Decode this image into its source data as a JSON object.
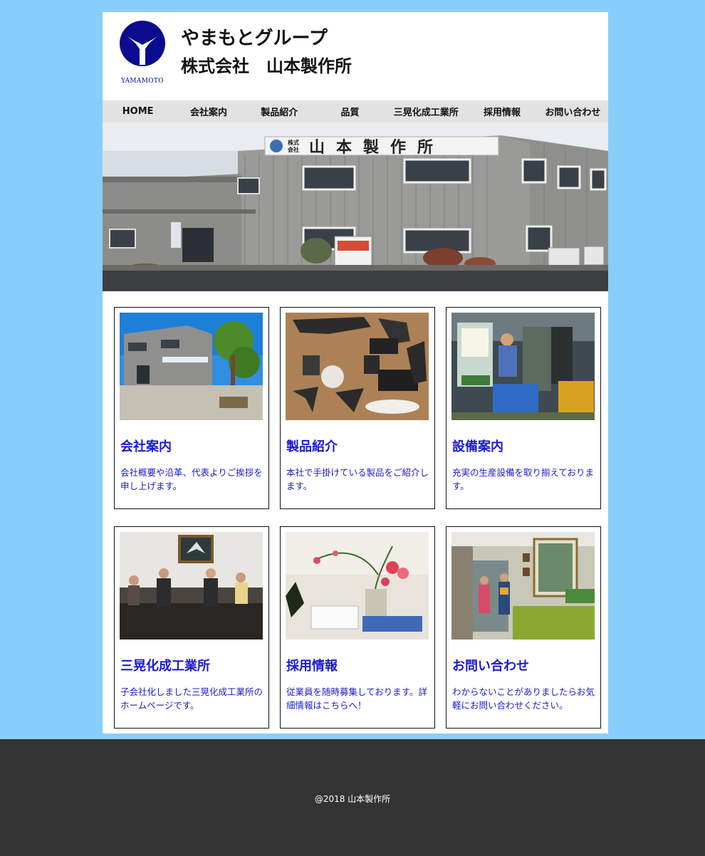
{
  "header": {
    "logo_text": "YAMAMOTO",
    "group_name": "やまもとグループ",
    "company_name": "株式会社　山本製作所"
  },
  "nav": {
    "items": [
      {
        "label": "HOME"
      },
      {
        "label": "会社案内"
      },
      {
        "label": "製品紹介"
      },
      {
        "label": "品質"
      },
      {
        "label": "三晃化成工業所"
      },
      {
        "label": "採用情報"
      },
      {
        "label": "お問い合わせ"
      }
    ]
  },
  "hero": {
    "sign_small_1": "株式",
    "sign_small_2": "会社",
    "sign_text": "山本製作所"
  },
  "cards": [
    {
      "title": "会社案内",
      "desc": "会社概要や沿革、代表よりご挨拶を申し上げます。"
    },
    {
      "title": "製品紹介",
      "desc": "本社で手掛けている製品をご紹介します。"
    },
    {
      "title": "設備案内",
      "desc": "充実の生産設備を取り揃えております。"
    },
    {
      "title": "三晃化成工業所",
      "desc": "子会社化しました三晃化成工業所のホームページです。"
    },
    {
      "title": "採用情報",
      "desc": "従業員を随時募集しております。詳細情報はこちらへ！"
    },
    {
      "title": "お問い合わせ",
      "desc": "わからないことがありましたらお気軽にお問い合わせください。"
    }
  ],
  "footer": {
    "copyright": "@2018 山本製作所"
  },
  "colors": {
    "background": "#87cefa",
    "link_blue": "#1a1ad0",
    "logo_navy": "#0b0b8f",
    "nav_bg": "#e2e2e2",
    "footer_bg": "#333333"
  }
}
